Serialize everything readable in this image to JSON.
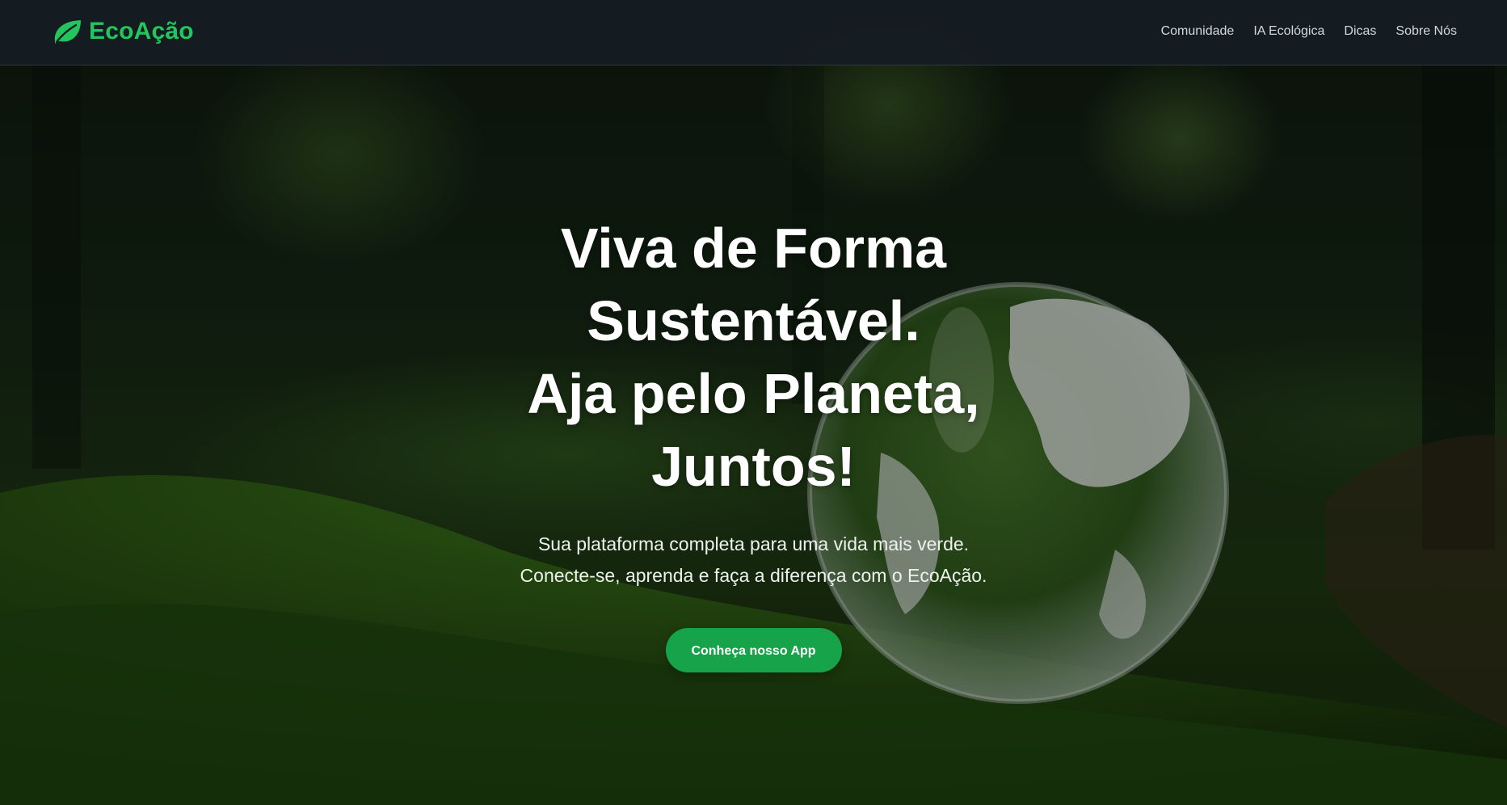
{
  "navbar": {
    "brand": "EcoAção",
    "brand_icon": "leaf-icon",
    "brand_color": "#22c55e",
    "links": [
      {
        "label": "Comunidade"
      },
      {
        "label": "IA Ecológica"
      },
      {
        "label": "Dicas"
      },
      {
        "label": "Sobre Nós"
      }
    ]
  },
  "hero": {
    "title_lines": [
      "Viva de Forma",
      "Sustentável.",
      "Aja pelo Planeta,",
      "Juntos!"
    ],
    "subtitle_lines": [
      "Sua plataforma completa para uma vida mais verde.",
      "Conecte-se, aprenda e faça a diferença com o EcoAção."
    ],
    "cta_label": "Conheça nosso App",
    "cta_color": "#16a34a"
  }
}
